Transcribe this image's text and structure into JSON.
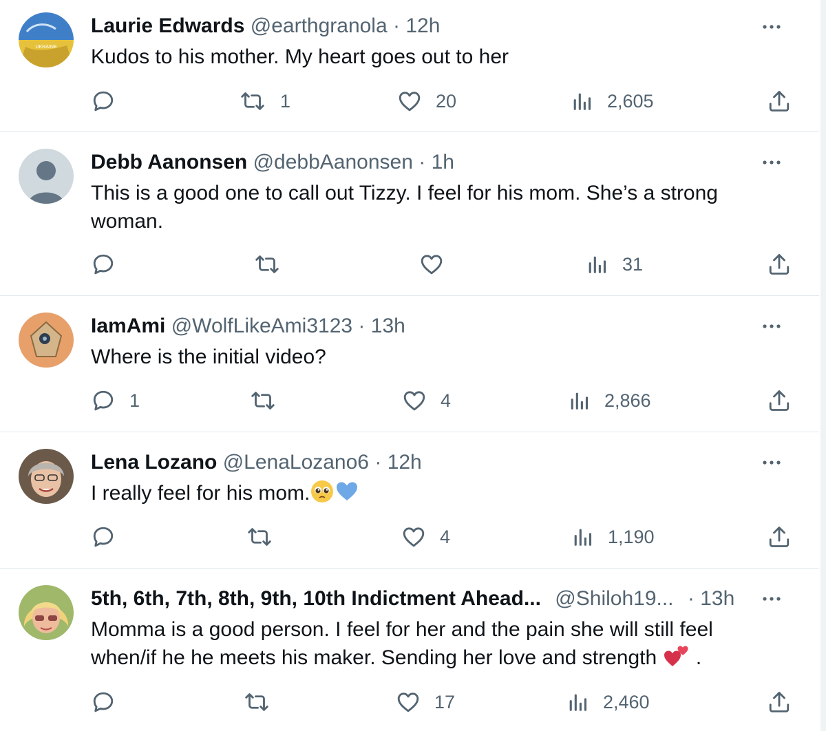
{
  "tweets": [
    {
      "name": "Laurie Edwards",
      "handle": "@earthgranola",
      "separator": "·",
      "time": "12h",
      "text": "Kudos to his mother. My heart goes out to her",
      "avatar_text": "UKRAINE",
      "stats": {
        "reply": "",
        "retweet": "1",
        "like": "20",
        "views": "2,605"
      }
    },
    {
      "name": "Debb Aanonsen",
      "handle": "@debbAanonsen",
      "separator": "·",
      "time": "1h",
      "text": "This is a good one to call out Tizzy. I feel for his mom. She’s a strong woman.",
      "stats": {
        "reply": "",
        "retweet": "",
        "like": "",
        "views": "31"
      }
    },
    {
      "name": "IamAmi",
      "handle": "@WolfLikeAmi3123",
      "separator": "·",
      "time": "13h",
      "text": "Where is the initial video?",
      "stats": {
        "reply": "1",
        "retweet": "",
        "like": "4",
        "views": "2,866"
      }
    },
    {
      "name": "Lena Lozano",
      "handle": "@LenaLozano6",
      "separator": "·",
      "time": "12h",
      "text": "I really feel for his mom.",
      "stats": {
        "reply": "",
        "retweet": "",
        "like": "4",
        "views": "1,190"
      }
    },
    {
      "name": "5th, 6th, 7th, 8th, 9th, 10th Indictment Ahead...",
      "handle": "@Shiloh19...",
      "separator": "·",
      "time": "13h",
      "text_line1": "Momma is a good person.  I feel for her and the pain she will still feel",
      "text_line2": "when/if he he meets his maker. Sending her love and strength",
      "text_end": ".",
      "stats": {
        "reply": "",
        "retweet": "",
        "like": "17",
        "views": "2,460"
      }
    }
  ],
  "icons": {
    "reply": "reply-icon",
    "retweet": "retweet-icon",
    "like": "heart-icon",
    "views": "views-icon",
    "share": "share-icon",
    "more": "more-icon"
  },
  "colors": {
    "text": "#0f1419",
    "secondary": "#536471",
    "divider": "#e1e8ed",
    "background": "#ffffff"
  }
}
